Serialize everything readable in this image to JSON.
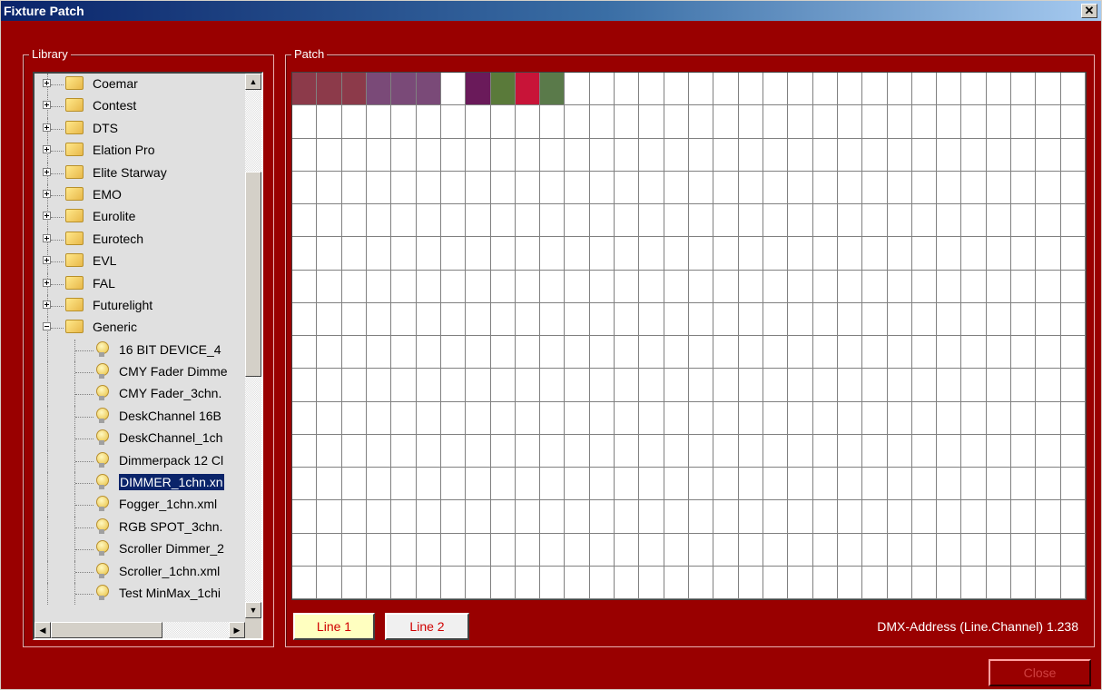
{
  "window": {
    "title": "Fixture Patch",
    "close_glyph": "✕"
  },
  "library": {
    "label": "Library",
    "folders": [
      "Coemar",
      "Contest",
      "DTS",
      "Elation Pro",
      "Elite Starway",
      "EMO",
      "Eurolite",
      "Eurotech",
      "EVL",
      "FAL",
      "Futurelight"
    ],
    "expanded_folder": "Generic",
    "children": [
      "16 BIT DEVICE_4",
      "CMY Fader Dimme",
      "CMY Fader_3chn.",
      "DeskChannel 16B",
      "DeskChannel_1ch",
      "Dimmerpack 12 Cl",
      "DIMMER_1chn.xn",
      "Fogger_1chn.xml",
      "RGB SPOT_3chn.",
      "Scroller Dimmer_2",
      "Scroller_1chn.xml",
      "Test MinMax_1chi"
    ],
    "selected_child": "DIMMER_1chn.xn",
    "icons": {
      "folder": "folder-icon",
      "fixture": "bulb-icon"
    }
  },
  "patch": {
    "label": "Patch",
    "columns": 32,
    "rows": 16,
    "patched_cells": [
      {
        "col": 0,
        "color": "#8c3a4a"
      },
      {
        "col": 1,
        "color": "#8c3a4a"
      },
      {
        "col": 2,
        "color": "#8c3a4a"
      },
      {
        "col": 3,
        "color": "#7a4a78"
      },
      {
        "col": 4,
        "color": "#7a4a78"
      },
      {
        "col": 5,
        "color": "#7a4a78"
      },
      {
        "col": 7,
        "color": "#6a1a5a"
      },
      {
        "col": 8,
        "color": "#5a7a3a"
      },
      {
        "col": 9,
        "color": "#c81438"
      },
      {
        "col": 10,
        "color": "#5a7a4a"
      }
    ],
    "line_buttons": [
      {
        "label": "Line 1",
        "active": true
      },
      {
        "label": "Line 2",
        "active": false
      }
    ],
    "dmx_address": "DMX-Address (Line.Channel) 1.238"
  },
  "footer": {
    "close_label": "Close"
  },
  "colors": {
    "background": "#990000",
    "active_line": "#ffffc0"
  }
}
